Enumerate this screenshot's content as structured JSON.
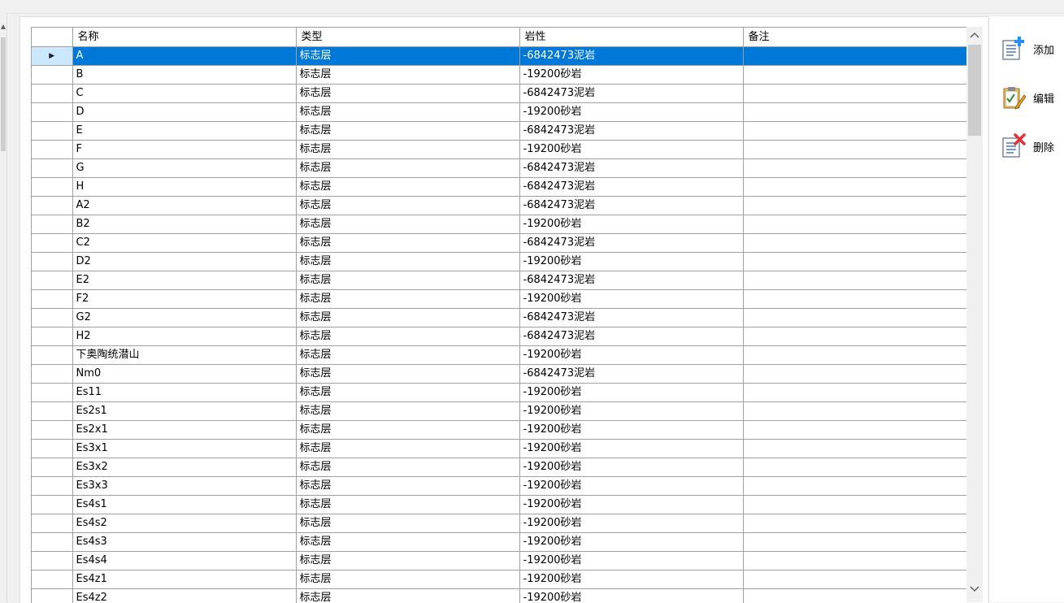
{
  "grid": {
    "columns": [
      "名称",
      "类型",
      "岩性",
      "备注"
    ],
    "selected_index": 0,
    "rows": [
      {
        "name": "A",
        "type": "标志层",
        "lithology": "-6842473泥岩",
        "note": ""
      },
      {
        "name": "B",
        "type": "标志层",
        "lithology": "-19200砂岩",
        "note": ""
      },
      {
        "name": "C",
        "type": "标志层",
        "lithology": "-6842473泥岩",
        "note": ""
      },
      {
        "name": "D",
        "type": "标志层",
        "lithology": "-19200砂岩",
        "note": ""
      },
      {
        "name": "E",
        "type": "标志层",
        "lithology": "-6842473泥岩",
        "note": ""
      },
      {
        "name": "F",
        "type": "标志层",
        "lithology": "-19200砂岩",
        "note": ""
      },
      {
        "name": "G",
        "type": "标志层",
        "lithology": "-6842473泥岩",
        "note": ""
      },
      {
        "name": "H",
        "type": "标志层",
        "lithology": "-6842473泥岩",
        "note": ""
      },
      {
        "name": "A2",
        "type": "标志层",
        "lithology": "-6842473泥岩",
        "note": ""
      },
      {
        "name": "B2",
        "type": "标志层",
        "lithology": "-19200砂岩",
        "note": ""
      },
      {
        "name": "C2",
        "type": "标志层",
        "lithology": "-6842473泥岩",
        "note": ""
      },
      {
        "name": "D2",
        "type": "标志层",
        "lithology": "-19200砂岩",
        "note": ""
      },
      {
        "name": "E2",
        "type": "标志层",
        "lithology": "-6842473泥岩",
        "note": ""
      },
      {
        "name": "F2",
        "type": "标志层",
        "lithology": "-19200砂岩",
        "note": ""
      },
      {
        "name": "G2",
        "type": "标志层",
        "lithology": "-6842473泥岩",
        "note": ""
      },
      {
        "name": "H2",
        "type": "标志层",
        "lithology": "-6842473泥岩",
        "note": ""
      },
      {
        "name": "下奥陶统潜山",
        "type": "标志层",
        "lithology": "-19200砂岩",
        "note": ""
      },
      {
        "name": "Nm0",
        "type": "标志层",
        "lithology": "-6842473泥岩",
        "note": ""
      },
      {
        "name": "Es11",
        "type": "标志层",
        "lithology": "-19200砂岩",
        "note": ""
      },
      {
        "name": "Es2s1",
        "type": "标志层",
        "lithology": "-19200砂岩",
        "note": ""
      },
      {
        "name": "Es2x1",
        "type": "标志层",
        "lithology": "-19200砂岩",
        "note": ""
      },
      {
        "name": "Es3x1",
        "type": "标志层",
        "lithology": "-19200砂岩",
        "note": ""
      },
      {
        "name": "Es3x2",
        "type": "标志层",
        "lithology": "-19200砂岩",
        "note": ""
      },
      {
        "name": "Es3x3",
        "type": "标志层",
        "lithology": "-19200砂岩",
        "note": ""
      },
      {
        "name": "Es4s1",
        "type": "标志层",
        "lithology": "-19200砂岩",
        "note": ""
      },
      {
        "name": "Es4s2",
        "type": "标志层",
        "lithology": "-19200砂岩",
        "note": ""
      },
      {
        "name": "Es4s3",
        "type": "标志层",
        "lithology": "-19200砂岩",
        "note": ""
      },
      {
        "name": "Es4s4",
        "type": "标志层",
        "lithology": "-19200砂岩",
        "note": ""
      },
      {
        "name": "Es4z1",
        "type": "标志层",
        "lithology": "-19200砂岩",
        "note": ""
      },
      {
        "name": "Es4z2",
        "type": "标志层",
        "lithology": "-19200砂岩",
        "note": ""
      }
    ]
  },
  "toolbar": {
    "add": {
      "label": "添加",
      "icon": "add-document-icon"
    },
    "edit": {
      "label": "编辑",
      "icon": "edit-clipboard-icon"
    },
    "delete": {
      "label": "删除",
      "icon": "delete-document-icon"
    }
  },
  "colors": {
    "selection": "#0078d7",
    "row_header_selected": "#cce8ff",
    "gridline": "#a0a0a0",
    "add_accent": "#1e90ff",
    "edit_accent": "#f5a623",
    "delete_accent": "#e0303a"
  }
}
